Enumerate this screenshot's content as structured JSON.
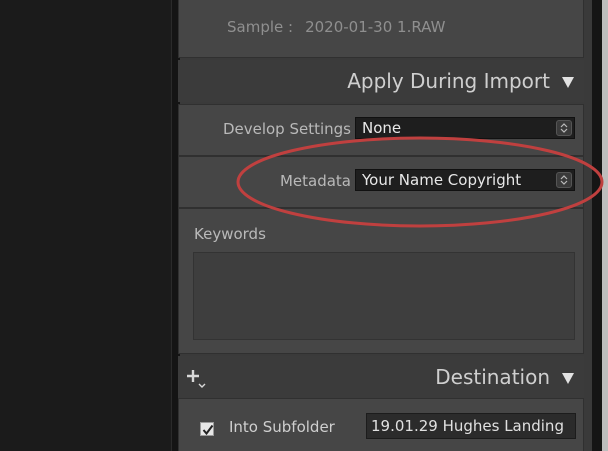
{
  "sample": {
    "label": "Sample :",
    "value": "2020-01-30 1.RAW"
  },
  "apply_during_import": {
    "title": "Apply During Import",
    "develop_settings": {
      "label": "Develop Settings",
      "value": "None"
    },
    "metadata": {
      "label": "Metadata",
      "value": "Your Name Copyright"
    },
    "keywords": {
      "label": "Keywords",
      "value": ""
    }
  },
  "destination": {
    "title": "Destination",
    "into_subfolder": {
      "label": "Into Subfolder",
      "checked": true,
      "value": "19.01.29 Hughes Landing"
    }
  },
  "colors": {
    "annotation_ellipse": "#c0403f",
    "panel_bg": "#3a3a3a"
  },
  "icons": {
    "collapse": "triangle-down-icon",
    "add": "plus-icon",
    "stepper": "updown-arrows-icon",
    "check": "checkmark-icon"
  }
}
